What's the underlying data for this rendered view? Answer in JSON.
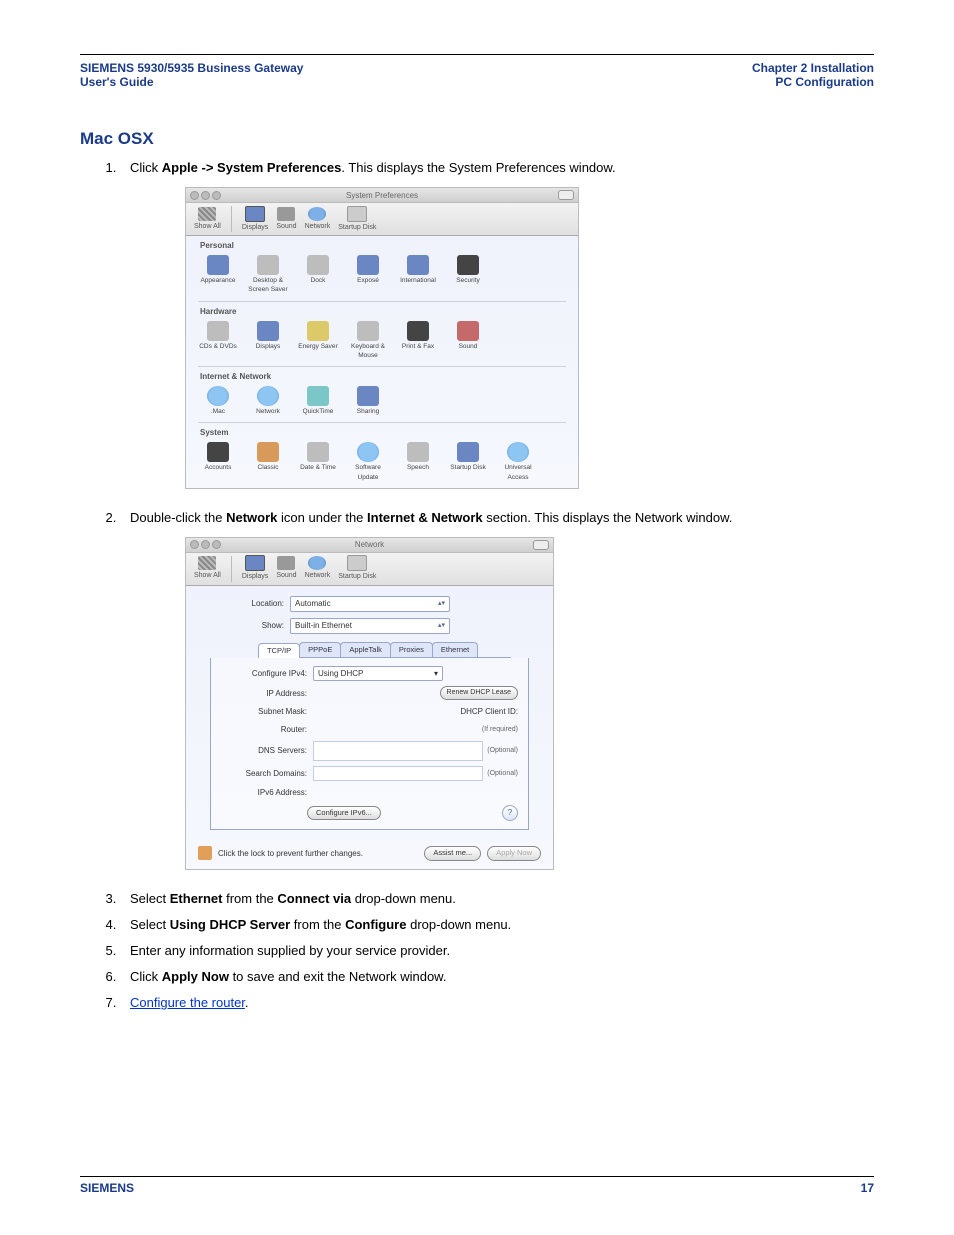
{
  "header": {
    "left_line1": "SIEMENS 5930/5935 Business Gateway",
    "left_line2": "User's Guide",
    "right_line1": "Chapter 2  Installation",
    "right_line2": "PC Configuration"
  },
  "section_title": "Mac OSX",
  "steps": {
    "s1_pre": "Click ",
    "s1_bold": "Apple -> System Preferences",
    "s1_post": ". This displays the System Preferences window.",
    "s2_pre": "Double-click the ",
    "s2_b1": "Network",
    "s2_mid": " icon under the ",
    "s2_b2": "Internet & Network",
    "s2_post": " section. This displays the Network window.",
    "s3_pre": "Select ",
    "s3_b1": "Ethernet",
    "s3_mid": " from the ",
    "s3_b2": "Connect via",
    "s3_post": " drop-down menu.",
    "s4_pre": "Select ",
    "s4_b1": "Using DHCP Server",
    "s4_mid": " from the ",
    "s4_b2": "Configure",
    "s4_post": " drop-down menu.",
    "s5": "Enter any information supplied by your service provider.",
    "s6_pre": "Click ",
    "s6_b1": "Apply Now",
    "s6_post": " to save and exit the Network window.",
    "s7_link": "Configure the router",
    "s7_post": "."
  },
  "syspref": {
    "title": "System Preferences",
    "toolbar": {
      "show_all": "Show All",
      "displays": "Displays",
      "sound": "Sound",
      "network": "Network",
      "startup": "Startup Disk"
    },
    "cat_personal": "Personal",
    "personal": {
      "appearance": "Appearance",
      "desktop": "Desktop & Screen Saver",
      "dock": "Dock",
      "expose": "Exposé",
      "international": "International",
      "security": "Security"
    },
    "cat_hardware": "Hardware",
    "hardware": {
      "cds": "CDs & DVDs",
      "displays": "Displays",
      "energy": "Energy Saver",
      "keyboard": "Keyboard & Mouse",
      "print": "Print & Fax",
      "sound": "Sound"
    },
    "cat_internet": "Internet & Network",
    "internet": {
      "mac": ".Mac",
      "network": "Network",
      "quicktime": "QuickTime",
      "sharing": "Sharing"
    },
    "cat_system": "System",
    "system": {
      "accounts": "Accounts",
      "classic": "Classic",
      "datetime": "Date & Time",
      "software": "Software Update",
      "speech": "Speech",
      "startup": "Startup Disk",
      "universal": "Universal Access"
    }
  },
  "network": {
    "title": "Network",
    "toolbar": {
      "show_all": "Show All",
      "displays": "Displays",
      "sound": "Sound",
      "network": "Network",
      "startup": "Startup Disk"
    },
    "location_label": "Location:",
    "location_value": "Automatic",
    "show_label": "Show:",
    "show_value": "Built-in Ethernet",
    "tabs": {
      "tcpip": "TCP/IP",
      "pppoe": "PPPoE",
      "appletalk": "AppleTalk",
      "proxies": "Proxies",
      "ethernet": "Ethernet"
    },
    "configure_label": "Configure IPv4:",
    "configure_value": "Using DHCP",
    "ip_label": "IP Address:",
    "renew_btn": "Renew DHCP Lease",
    "subnet_label": "Subnet Mask:",
    "dhcp_client_label": "DHCP Client ID:",
    "if_required": "(If required)",
    "router_label": "Router:",
    "dns_label": "DNS Servers:",
    "optional": "(Optional)",
    "search_label": "Search Domains:",
    "ipv6addr_label": "IPv6 Address:",
    "configure_ipv6_btn": "Configure IPv6...",
    "lock_text": "Click the lock to prevent further changes.",
    "assist_btn": "Assist me...",
    "apply_btn": "Apply Now"
  },
  "footer": {
    "brand": "SIEMENS",
    "page": "17"
  }
}
